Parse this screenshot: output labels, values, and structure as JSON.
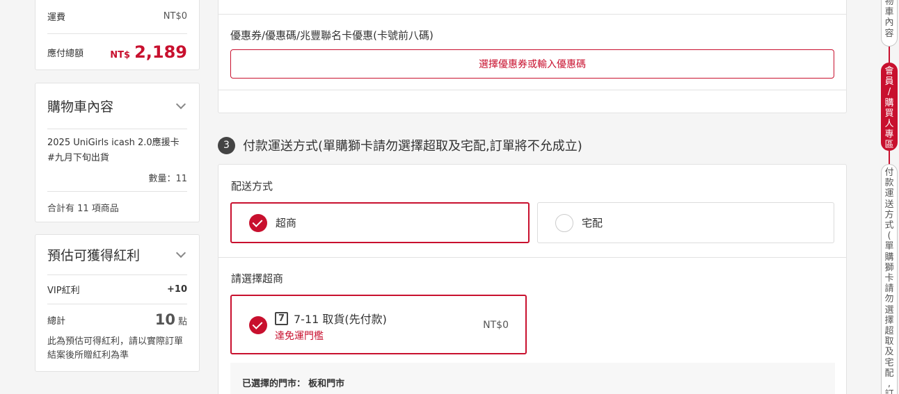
{
  "summary": {
    "shipping_label": "運費",
    "shipping_value": "NT$0",
    "total_label": "應付總額",
    "total_currency": "NT$",
    "total_amount": "2,189"
  },
  "cart": {
    "title": "購物車內容",
    "item_name": "2025 UniGirls icash 2.0應援卡 #九月下旬出貨",
    "quantity": "數量：11",
    "count_text": "合計有 11 項商品"
  },
  "bonus": {
    "title": "預估可獲得紅利",
    "vip_label": "VIP紅利",
    "vip_value": "+10",
    "total_label": "總計",
    "total_value": "10",
    "total_unit": "點",
    "note": "此為預估可得紅利，請以實際訂單結案後所贈紅利為準"
  },
  "coupon": {
    "label": "優惠券/優惠碼/兆豐聯名卡優惠(卡號前八碼)",
    "button": "選擇優惠券或輸入優惠碼"
  },
  "step3": {
    "number": "3",
    "title": "付款運送方式(單購獅卡請勿選擇超取及宅配,訂單將不允成立)"
  },
  "delivery": {
    "label": "配送方式",
    "option_store": "超商",
    "option_home": "宅配",
    "selected": "超商"
  },
  "store": {
    "label": "請選擇超商",
    "icon_char": "7",
    "option_name": "7-11 取貨(先付款)",
    "option_note": "達免運門檻",
    "option_price": "NT$0",
    "chosen_label": "已選擇的門市：",
    "chosen_value": "板和門市"
  },
  "side_nav": {
    "item1": "物車內容",
    "item2": "會員/購買人專區",
    "item3": "付款運送方式(單購獅卡請勿選擇超取及宅配,訂單"
  },
  "colors": {
    "accent": "#c8102e",
    "step_badge": "#444444"
  }
}
